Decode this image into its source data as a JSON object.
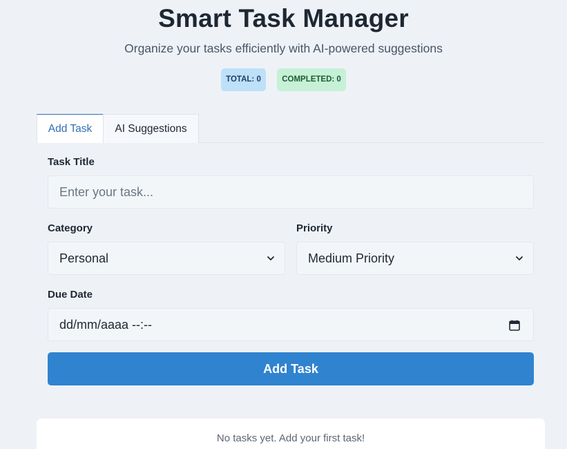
{
  "header": {
    "title": "Smart Task Manager",
    "subtitle": "Organize your tasks efficiently with AI-powered suggestions"
  },
  "stats": {
    "total_label": "TOTAL: 0",
    "completed_label": "COMPLETED: 0"
  },
  "tabs": [
    {
      "label": "Add Task",
      "active": true
    },
    {
      "label": "AI Suggestions",
      "active": false
    }
  ],
  "form": {
    "title_label": "Task Title",
    "title_placeholder": "Enter your task...",
    "title_value": "",
    "category_label": "Category",
    "category_value": "Personal",
    "priority_label": "Priority",
    "priority_value": "Medium Priority",
    "due_label": "Due Date",
    "due_value": "dd/mm/aaaa --:--",
    "submit_label": "Add Task"
  },
  "task_list": {
    "empty_message": "No tasks yet. Add your first task!"
  },
  "colors": {
    "accent": "#3083cf",
    "background": "#eef2f7",
    "total_badge": "#bee0f8",
    "completed_badge": "#c6f1d6"
  },
  "icons": [
    "chevron-down-icon",
    "calendar-icon"
  ]
}
